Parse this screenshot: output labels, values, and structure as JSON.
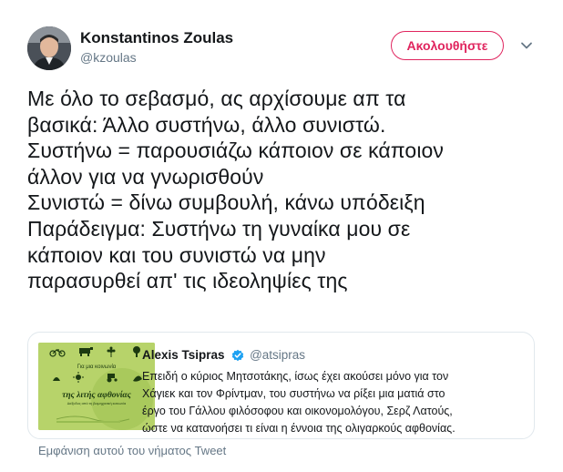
{
  "author": {
    "name": "Konstantinos Zoulas",
    "handle": "@kzoulas"
  },
  "follow_button": {
    "label": "Ακολουθήστε",
    "color": "#e0245e"
  },
  "tweet": {
    "lines": [
      "Με όλο το σεβασμό, ας αρχίσουμε απ τα",
      "βασικά: Άλλο συστήνω, άλλο συνιστώ.",
      "Συστήνω = παρουσιάζω κάποιον σε κάποιον",
      "άλλον για να γνωρισθούν",
      "Συνιστώ = δίνω συμβουλή, κάνω υπόδειξη",
      "Παράδειγμα: Συστήνω τη γυναίκα μου σε",
      "κάποιον και του συνιστώ να μην",
      "παρασυρθεί απ' τις ιδεοληψίες της"
    ]
  },
  "quoted_tweet": {
    "author_name": "Alexis Tsipras",
    "author_handle": "@atsipras",
    "verified_badge_color": "#1da1f2",
    "lines": [
      "Επειδή ο κύριος Μητσοτάκης, ίσως έχει ακούσει μόνο για τον",
      "Χάγιεκ και τον Φρίντμαν, του συστήνω να ρίξει μια ματιά στο",
      "έργο του Γάλλου φιλόσοφου και οικονομολόγου, Σερζ Λατούς,",
      "ώστε να κατανοήσει τι είναι η  έννοια της ολιγαρκούς αφθονίας."
    ],
    "image": {
      "title_top": "Για μια κοινωνία",
      "title_main": "της λιτής αφθονίας",
      "subtitle": "Διέξοδος από τη βιομηχανική κοινωνία",
      "background_color": "#b7d36a"
    }
  },
  "show_thread": {
    "label": "Εμφάνιση αυτού του νήματος Tweet"
  }
}
